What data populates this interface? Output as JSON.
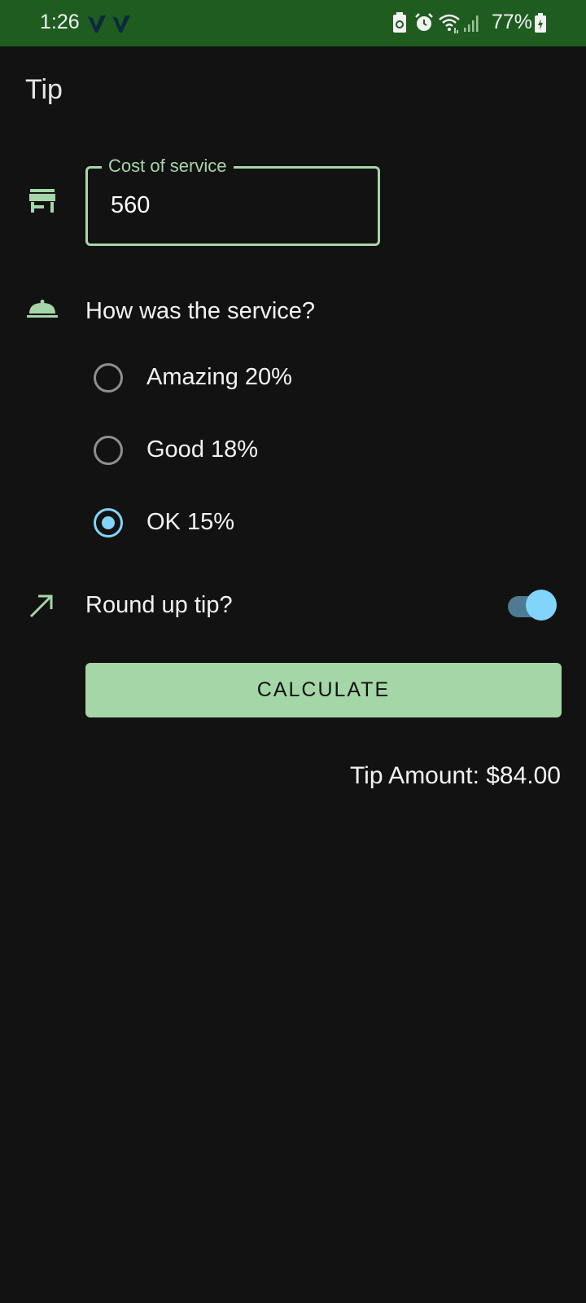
{
  "status_bar": {
    "time": "1:26",
    "battery": "77%",
    "notification_icons": [
      "v-logo-icon",
      "v-logo-icon"
    ],
    "system_icons": [
      "data-saver-icon",
      "alarm-icon",
      "wifi-icon",
      "signal-icon",
      "battery-charging-icon"
    ],
    "background_color": "#1e5c20"
  },
  "app": {
    "title": "Tip"
  },
  "cost_field": {
    "label": "Cost of service",
    "value": "560",
    "icon": "store-icon"
  },
  "service": {
    "question": "How was the service?",
    "icon": "room-service-bell-icon",
    "options": [
      {
        "label": "Amazing 20%",
        "selected": false
      },
      {
        "label": "Good 18%",
        "selected": false
      },
      {
        "label": "OK 15%",
        "selected": true
      }
    ]
  },
  "round_up": {
    "label": "Round up tip?",
    "icon": "trending-up-arrow-icon",
    "enabled": true
  },
  "calculate_button": {
    "label": "CALCULATE"
  },
  "result": {
    "text": "Tip Amount: $84.00"
  },
  "colors": {
    "background": "#121212",
    "accent_green": "#a5d6a7",
    "accent_blue": "#81d4fa"
  }
}
